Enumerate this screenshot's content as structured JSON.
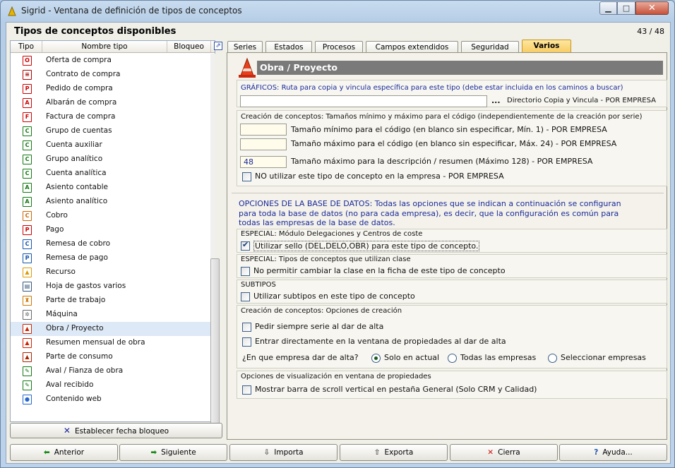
{
  "window": {
    "title": "Sigrid - Ventana de definición de tipos de conceptos",
    "min_icon": "minimize-icon",
    "max_icon": "maximize-icon",
    "close_icon": "close-icon"
  },
  "header": {
    "title": "Tipos de conceptos disponibles",
    "count": "43 / 48"
  },
  "list": {
    "columns": [
      "Tipo",
      "Nombre tipo",
      "Bloqueo"
    ],
    "items": [
      {
        "label": "Oferta de compra",
        "icon": "document-red-icon",
        "glyph": "O",
        "color": "#cc0000"
      },
      {
        "label": "Contrato de compra",
        "icon": "contract-icon",
        "glyph": "≡",
        "color": "#aa0000"
      },
      {
        "label": "Pedido de compra",
        "icon": "document-red-icon",
        "glyph": "P",
        "color": "#cc0000"
      },
      {
        "label": "Albarán de compra",
        "icon": "document-red-icon",
        "glyph": "A",
        "color": "#cc0000"
      },
      {
        "label": "Factura de compra",
        "icon": "document-red-icon",
        "glyph": "F",
        "color": "#cc0000"
      },
      {
        "label": "Grupo de cuentas",
        "icon": "document-green-icon",
        "glyph": "C",
        "color": "#117711"
      },
      {
        "label": "Cuenta auxiliar",
        "icon": "document-green-icon",
        "glyph": "C",
        "color": "#117711"
      },
      {
        "label": "Grupo analítico",
        "icon": "document-green-icon",
        "glyph": "C",
        "color": "#117711"
      },
      {
        "label": "Cuenta analítica",
        "icon": "document-green-icon",
        "glyph": "C",
        "color": "#117711"
      },
      {
        "label": "Asiento contable",
        "icon": "document-green-icon",
        "glyph": "A",
        "color": "#117711"
      },
      {
        "label": "Asiento analítico",
        "icon": "document-green-icon",
        "glyph": "A",
        "color": "#117711"
      },
      {
        "label": "Cobro",
        "icon": "document-yellow-icon",
        "glyph": "C",
        "color": "#cc6600"
      },
      {
        "label": "Pago",
        "icon": "document-yellow-icon",
        "glyph": "P",
        "color": "#cc0000"
      },
      {
        "label": "Remesa de cobro",
        "icon": "document-blue-icon",
        "glyph": "C",
        "color": "#1155aa"
      },
      {
        "label": "Remesa de pago",
        "icon": "document-blue-icon",
        "glyph": "P",
        "color": "#1155aa"
      },
      {
        "label": "Recurso",
        "icon": "helmet-icon",
        "glyph": "▲",
        "color": "#dd9900"
      },
      {
        "label": "Hoja de gastos varios",
        "icon": "sheet-icon",
        "glyph": "▤",
        "color": "#335577"
      },
      {
        "label": "Parte de trabajo",
        "icon": "worker-icon",
        "glyph": "♜",
        "color": "#cc7700"
      },
      {
        "label": "Máquina",
        "icon": "gear-icon",
        "glyph": "✲",
        "color": "#666666"
      },
      {
        "label": "Obra / Proyecto",
        "icon": "cone-icon",
        "glyph": "▲",
        "color": "#cc2200"
      },
      {
        "label": "Resumen mensual de obra",
        "icon": "cone-icon",
        "glyph": "▲",
        "color": "#cc2200"
      },
      {
        "label": "Parte de consumo",
        "icon": "cone-icon",
        "glyph": "▲",
        "color": "#aa2200"
      },
      {
        "label": "Aval / Fianza de obra",
        "icon": "pen-icon",
        "glyph": "✎",
        "color": "#117711"
      },
      {
        "label": "Aval recibido",
        "icon": "pen-icon",
        "glyph": "✎",
        "color": "#117711"
      },
      {
        "label": "Contenido web",
        "icon": "globe-icon",
        "glyph": "●",
        "color": "#2266cc"
      }
    ],
    "selected_index": 19,
    "lock_button": "Establecer fecha bloqueo"
  },
  "tabs": [
    {
      "label": "Series",
      "active": false
    },
    {
      "label": "Estados",
      "active": false
    },
    {
      "label": "Procesos",
      "active": false
    },
    {
      "label": "Campos extendidos",
      "active": false
    },
    {
      "label": "Seguridad",
      "active": false
    },
    {
      "label": "Varios",
      "active": true
    }
  ],
  "panel": {
    "title": "Obra / Proyecto",
    "graficos": {
      "label": "GRÁFICOS: Ruta para copia y vincula específica para este tipo (debe estar incluida en los caminos a buscar)",
      "value": "",
      "dots": "...",
      "note": "Directorio Copia y Vincula - POR EMPRESA"
    },
    "creacion": {
      "label": "Creación de conceptos: Tamaños mínimo y máximo para el código (independientemente de la creación por serie)",
      "min_value": "",
      "min_label": "Tamaño mínimo para el código (en blanco sin especificar, Mín. 1) - POR EMPRESA",
      "max_value": "",
      "max_label": "Tamaño máximo para el código (en blanco sin especificar, Máx. 24) - POR EMPRESA",
      "desc_value": "48",
      "desc_label": "Tamaño máximo para la descripción / resumen (Máximo 128) - POR EMPRESA",
      "no_usar_label": "NO utilizar este tipo de concepto en la empresa - POR EMPRESA",
      "no_usar_checked": false
    },
    "opciones_text": "OPCIONES DE LA BASE DE DATOS: Todas las opciones que se indican a continuación se configuran para toda la base de datos (no para cada empresa), es decir, que la configuración es común para todas las empresas de la base de datos.",
    "especial1": {
      "label": "ESPECIAL: Módulo Delegaciones y Centros de coste",
      "cb_label": "Utilizar sello (DEL,DELO,OBR) para este tipo de concepto.",
      "checked": true
    },
    "especial2": {
      "label": "ESPECIAL: Tipos de conceptos que utilizan clase",
      "cb_label": "No permitir cambiar la clase en la ficha de este tipo de concepto",
      "checked": false
    },
    "subtipos": {
      "label": "SUBTIPOS",
      "cb_label": "Utilizar subtipos en este tipo de concepto",
      "checked": false
    },
    "opc_creacion": {
      "label": "Creación de conceptos: Opciones de creación",
      "cb1": "Pedir siempre serie al dar de alta",
      "cb2": "Entrar directamente en la ventana de propiedades al dar de alta",
      "question": "¿En que empresa dar de alta?",
      "r1": "Solo en actual",
      "r2": "Todas las empresas",
      "r3": "Seleccionar empresas",
      "selected": "r1"
    },
    "visual": {
      "label": "Opciones de visualización en ventana de propiedades",
      "cb_label": "Mostrar barra de scroll vertical en pestaña General (Solo CRM y Calidad)",
      "checked": false
    }
  },
  "buttons": [
    {
      "label": "Anterior",
      "icon": "arrow-left-icon",
      "glyph": "⬅",
      "color": "#1a8a1a"
    },
    {
      "label": "Siguiente",
      "icon": "arrow-right-icon",
      "glyph": "➡",
      "color": "#1a8a1a"
    },
    {
      "label": "Importa",
      "icon": "import-icon",
      "glyph": "⇩",
      "color": "#555555"
    },
    {
      "label": "Exporta",
      "icon": "export-icon",
      "glyph": "⇧",
      "color": "#555555"
    },
    {
      "label": "Cierra",
      "icon": "close-x-icon",
      "glyph": "✕",
      "color": "#cc1111"
    },
    {
      "label": "Ayuda...",
      "icon": "help-icon",
      "glyph": "?",
      "color": "#2255aa"
    }
  ]
}
